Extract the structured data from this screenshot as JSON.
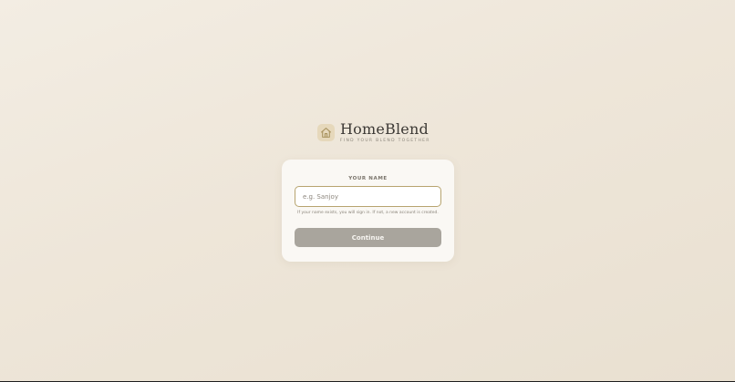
{
  "brand": {
    "name": "HomeBlend",
    "tagline": "FIND YOUR BLEND TOGETHER",
    "logo_icon": "house-icon",
    "accent": "#b7a46f"
  },
  "login": {
    "label": "YOUR NAME",
    "placeholder": "e.g. Sanjoy",
    "value": "",
    "hint": "If your name exists, you will sign in. If not, a new account is created.",
    "continue_label": "Continue"
  }
}
